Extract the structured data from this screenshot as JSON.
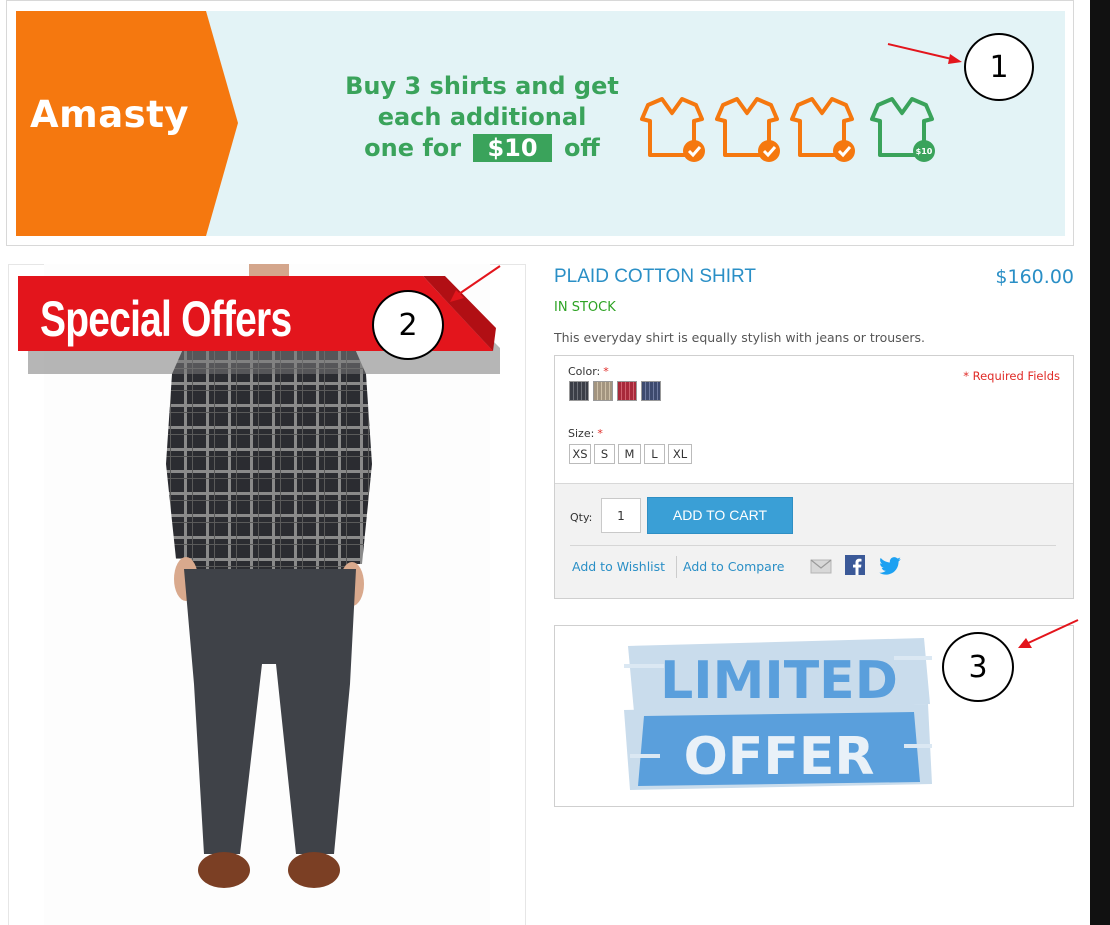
{
  "banner": {
    "brand": "masty",
    "brand_letter": "A",
    "promo_line1": "Buy 3 shirts and get",
    "promo_line2": "each additional",
    "promo_line3_before": "one for",
    "promo_price": "$10",
    "promo_line3_after": "off",
    "icon_badge": "$10",
    "colors": {
      "orange": "#f5780f",
      "green": "#3aa35b",
      "background": "#e3f3f6"
    }
  },
  "callouts": [
    "1",
    "2",
    "3"
  ],
  "ribbon": {
    "label": "Special Offers",
    "color": "#e3151c"
  },
  "product": {
    "title": "PLAID COTTON SHIRT",
    "price": "$160.00",
    "stock": "IN STOCK",
    "description": "This everyday shirt is equally stylish with jeans or trousers."
  },
  "options": {
    "color_label": "Color",
    "required_star": "*",
    "required_note": "* Required Fields",
    "swatches": [
      "#3b3e47",
      "#a39580",
      "#a8293a",
      "#3d4a6e"
    ],
    "size_label": "Size",
    "sizes": [
      "XS",
      "S",
      "M",
      "L",
      "XL"
    ]
  },
  "cart": {
    "qty_label": "Qty:",
    "qty_value": "1",
    "add_to_cart": "ADD TO CART",
    "wishlist": "Add to Wishlist",
    "compare": "Add to Compare"
  },
  "limited_offer": {
    "line1": "LIMITED",
    "line2": "OFFER",
    "color": "#5a9fdc"
  }
}
